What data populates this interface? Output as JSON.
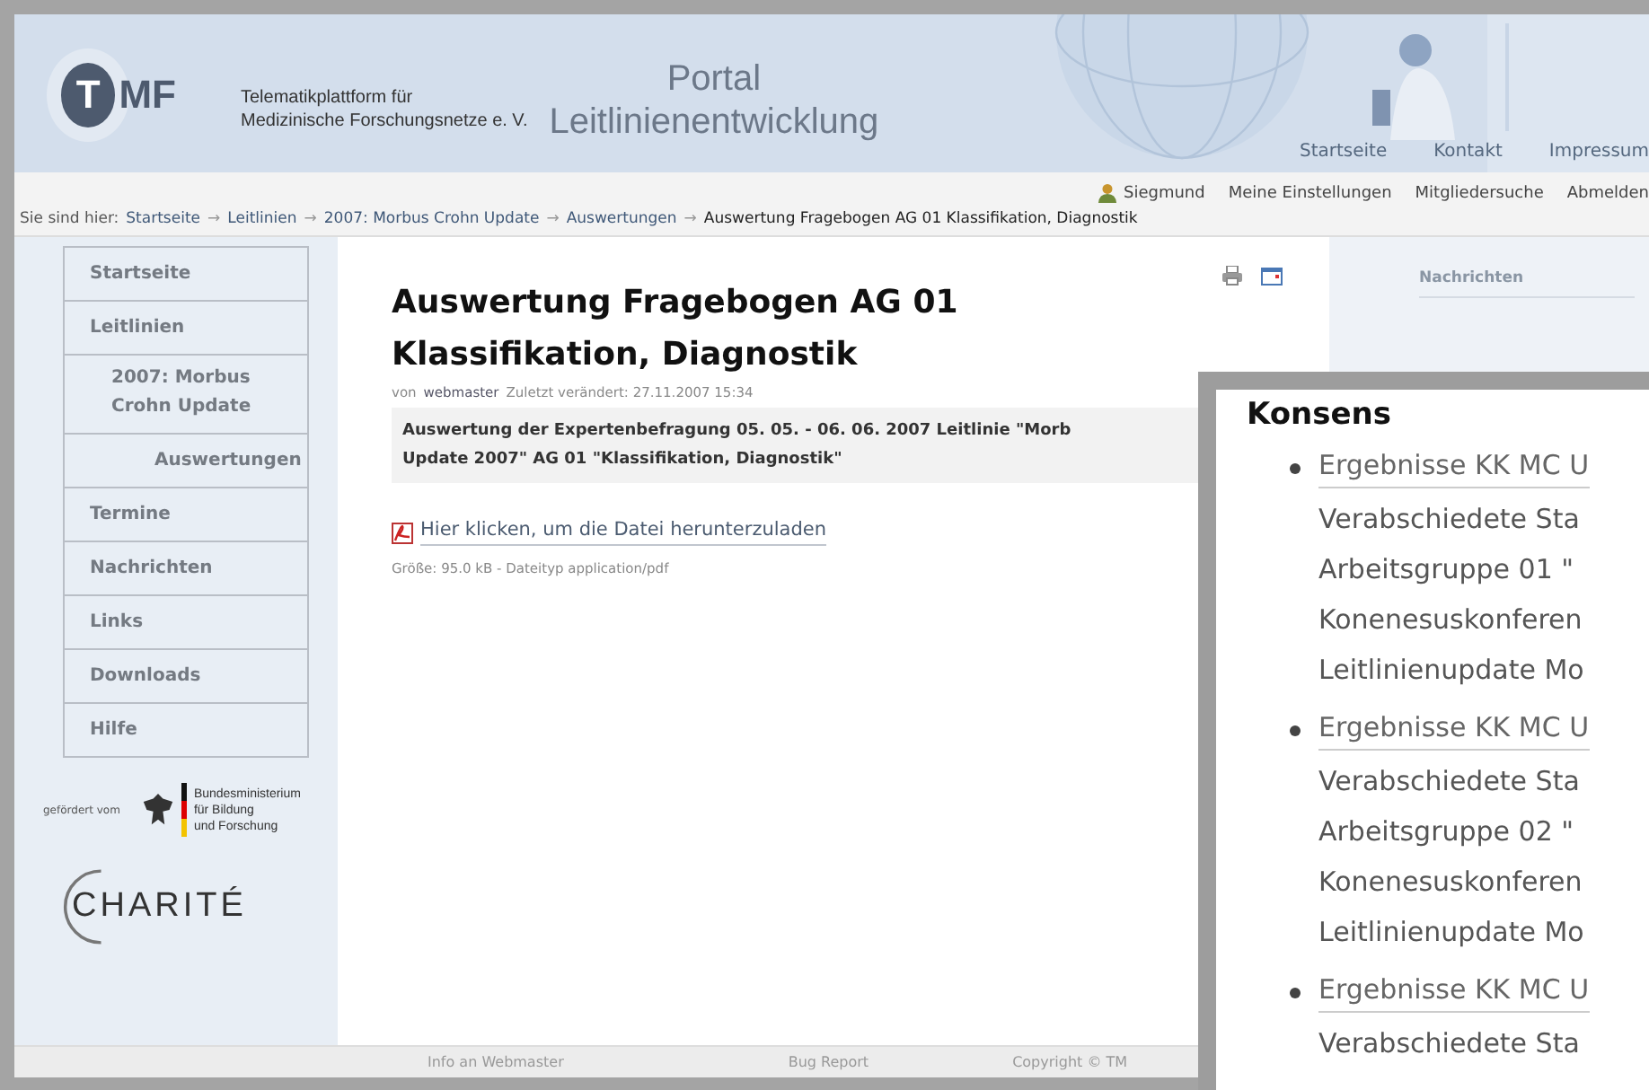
{
  "header": {
    "logo": {
      "initial": "T",
      "rest": "MF"
    },
    "org_name": [
      "Telematikplattform für",
      "Medizinische Forschungsnetze e. V."
    ],
    "portal_title": [
      "Portal",
      "Leitlinienentwicklung"
    ],
    "nav": [
      "Startseite",
      "Kontakt",
      "Impressum"
    ]
  },
  "user_bar": {
    "user": "Siegmund",
    "links": [
      "Meine Einstellungen",
      "Mitgliedersuche",
      "Abmelden"
    ]
  },
  "breadcrumb": {
    "prefix": "Sie sind hier:",
    "items": [
      {
        "kind": "link",
        "text": "Startseite"
      },
      {
        "kind": "separator",
        "text": "→"
      },
      {
        "kind": "link",
        "text": "Leitlinien"
      },
      {
        "kind": "separator",
        "text": "→"
      },
      {
        "kind": "link",
        "text": "2007: Morbus Crohn Update"
      },
      {
        "kind": "separator",
        "text": "→"
      },
      {
        "kind": "link",
        "text": "Auswertungen"
      },
      {
        "kind": "separator",
        "text": "→"
      },
      {
        "kind": "current",
        "text": "Auswertung Fragebogen AG 01 Klassifikation, Diagnostik"
      }
    ]
  },
  "sidebar": {
    "items": [
      {
        "label": "Startseite"
      },
      {
        "label": "Leitlinien",
        "children": [
          {
            "label": "2007: Morbus Crohn Update",
            "children": [
              {
                "label": "Auswertungen"
              }
            ]
          }
        ]
      },
      {
        "label": "Termine"
      },
      {
        "label": "Nachrichten"
      },
      {
        "label": "Links"
      },
      {
        "label": "Downloads"
      },
      {
        "label": "Hilfe"
      }
    ],
    "sponsor": {
      "label": "gefördert vom",
      "ministry": [
        "Bundesministerium",
        "für Bildung",
        "und Forschung"
      ]
    },
    "partner": "CHARITÉ"
  },
  "article": {
    "title": [
      "Auswertung Fragebogen AG 01",
      "Klassifikation, Diagnostik"
    ],
    "byline": {
      "prefix": "von",
      "author": "webmaster",
      "modified": "Zuletzt verändert: 27.11.2007 15:34"
    },
    "description": [
      "Auswertung der Expertenbefragung 05. 05. - 06. 06. 2007 Leitlinie \"Morb",
      "Update 2007\" AG 01 \"Klassifikation, Diagnostik\""
    ],
    "download_link": "Hier klicken, um die Datei herunterzuladen",
    "file_info": "Größe: 95.0 kB - Dateityp application/pdf"
  },
  "right_column": {
    "heading": "Nachrichten"
  },
  "footer": {
    "links": [
      "Info an Webmaster",
      "Bug Report",
      "Copyright © TM"
    ]
  },
  "overlay": {
    "heading": "Konsens",
    "items": [
      {
        "link": "Ergebnisse KK MC U",
        "lines": [
          "Verabschiedete Sta",
          "Arbeitsgruppe 01 \"",
          "Konenesuskonferen",
          "Leitlinienupdate Mo"
        ]
      },
      {
        "link": "Ergebnisse KK MC U",
        "lines": [
          "Verabschiedete Sta",
          "Arbeitsgruppe 02 \"",
          "Konenesuskonferen",
          "Leitlinienupdate Mo"
        ]
      },
      {
        "link": "Ergebnisse KK MC U",
        "lines": [
          "Verabschiedete Sta"
        ]
      }
    ]
  }
}
